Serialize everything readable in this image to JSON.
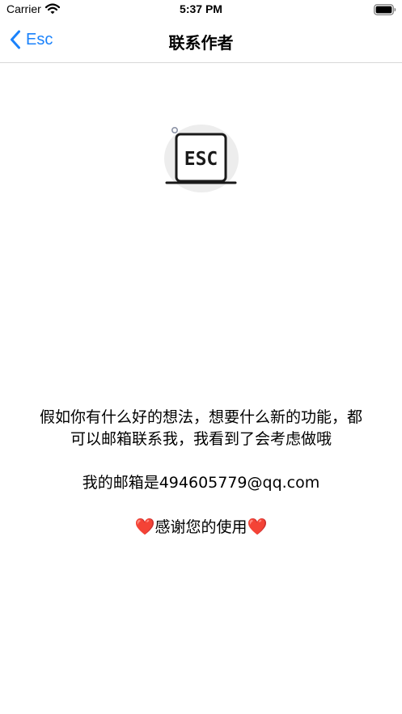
{
  "status_bar": {
    "carrier": "Carrier",
    "time": "5:37 PM",
    "icons": [
      "wifi-icon",
      "battery-icon"
    ]
  },
  "nav": {
    "back_label": "Esc",
    "title": "联系作者",
    "accent_color": "#1a82fb"
  },
  "logo": {
    "text": "ESC",
    "icon": "laptop-esc-logo"
  },
  "message": {
    "line1": "假如你有什么好的想法，想要什么新的功能，都",
    "line2": "可以邮箱联系我，我看到了会考虑做哦",
    "email_line": "我的邮箱是494605779@qq.com",
    "thanks_text": "感谢您的使用",
    "heart_glyph": "❤️",
    "heart_color": "#e0162b"
  }
}
